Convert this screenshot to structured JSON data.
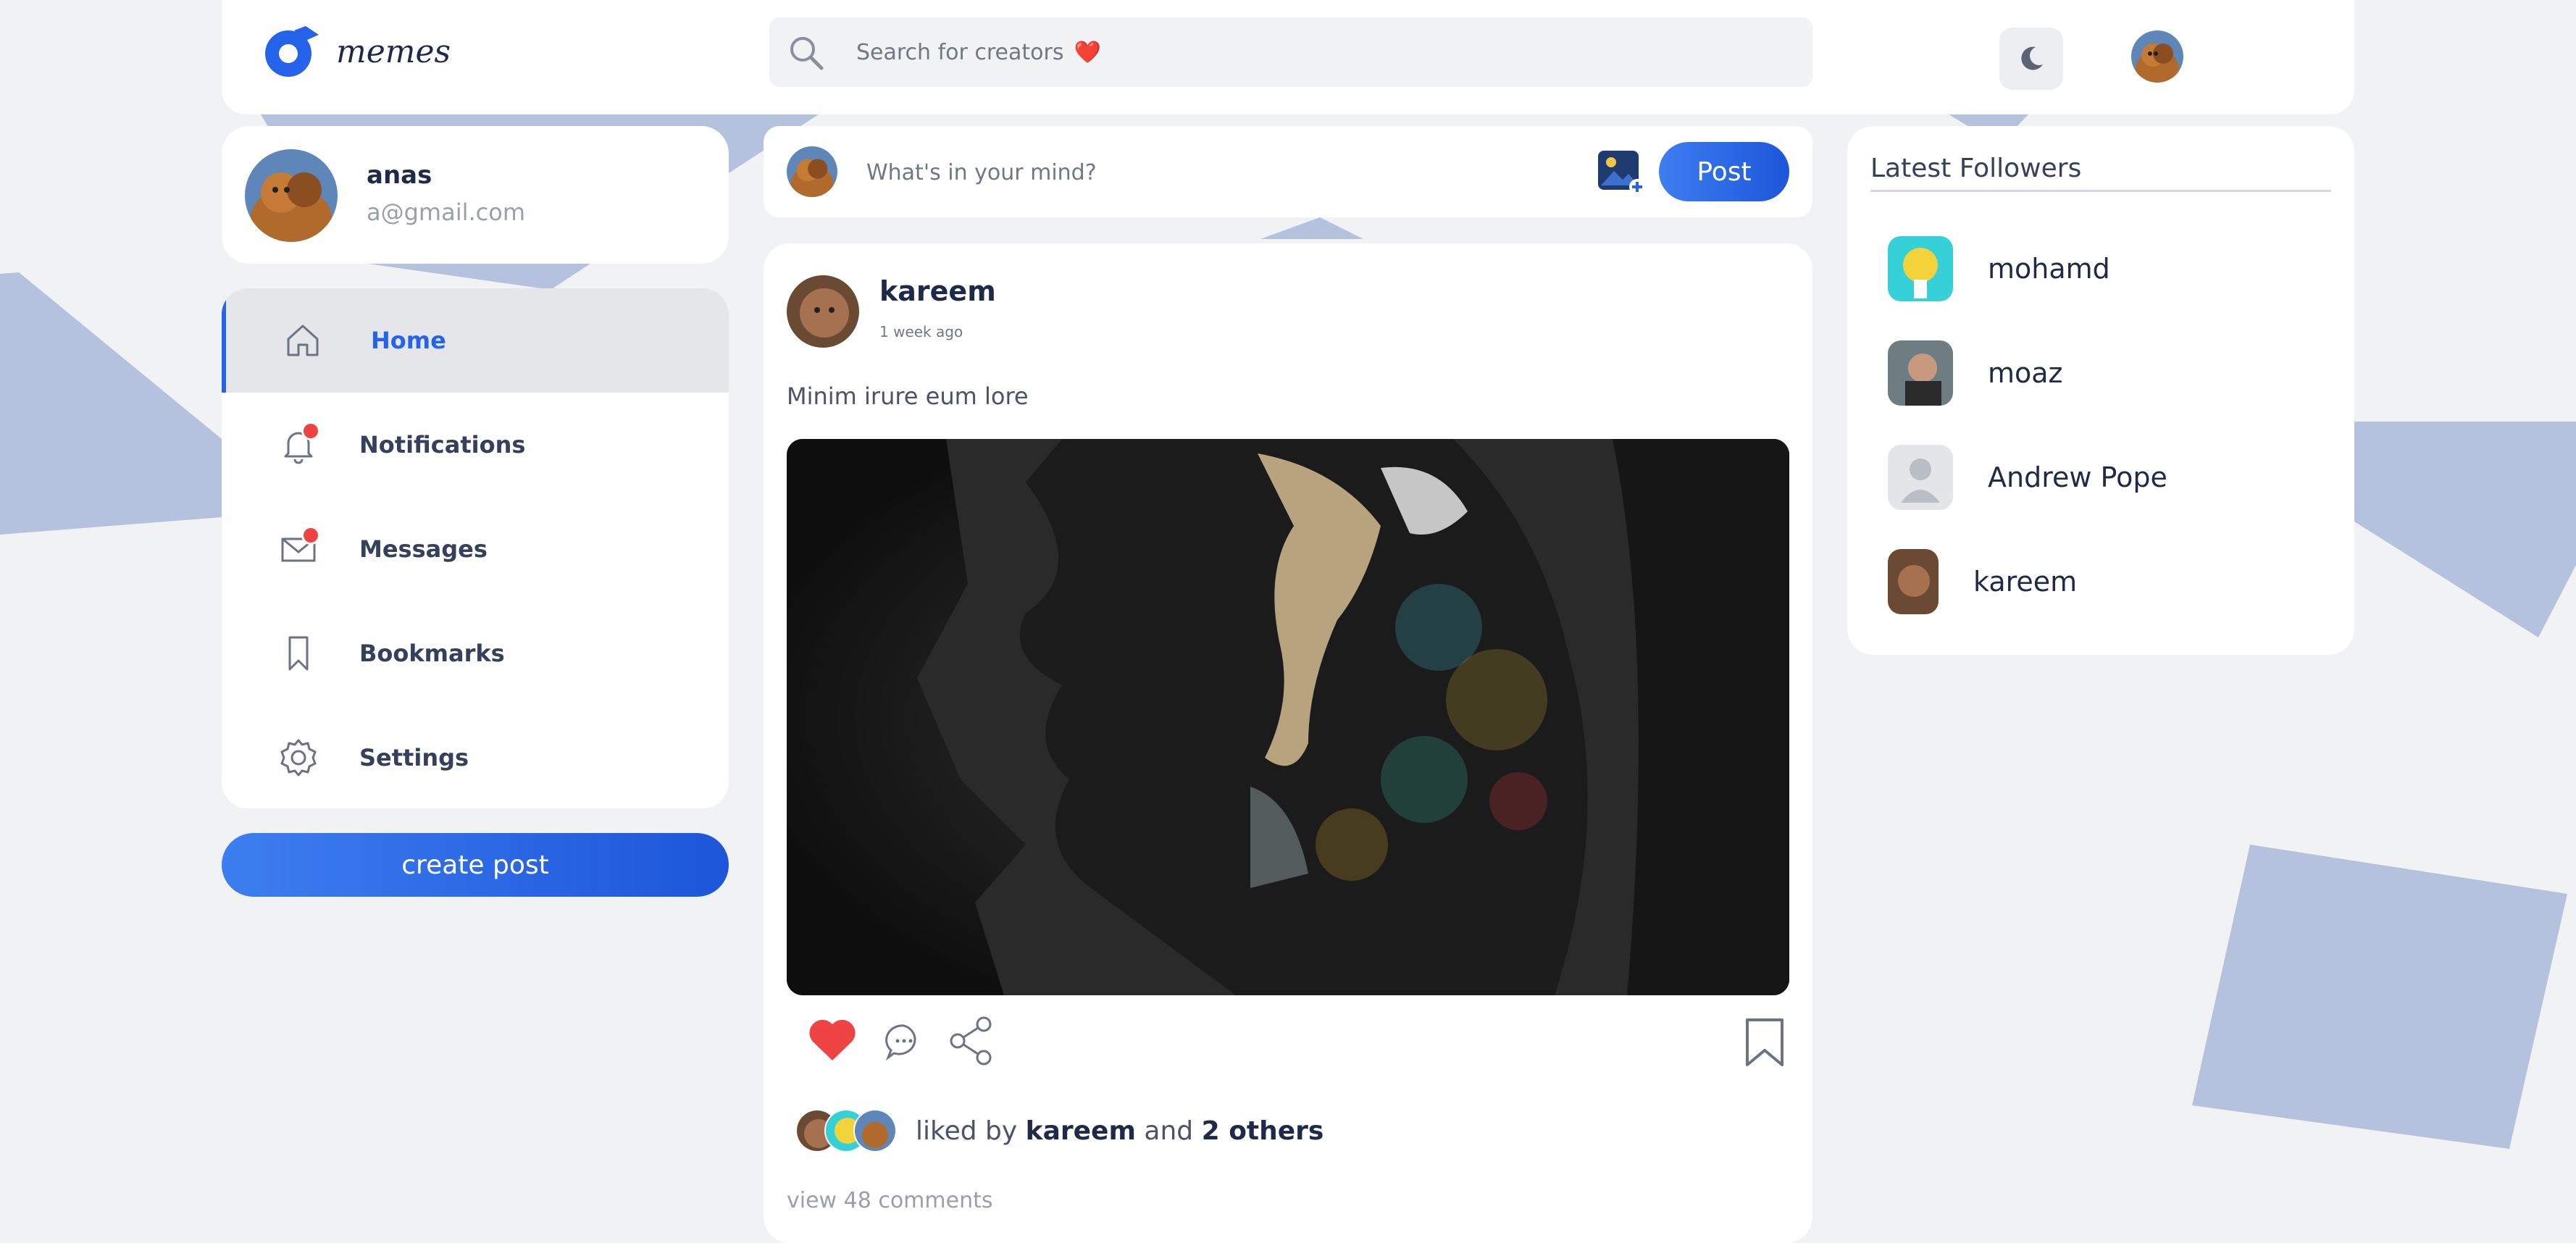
{
  "app": {
    "name": "memes",
    "accent_color": "#2563eb",
    "shape_color": "#b4c2de"
  },
  "header": {
    "search_placeholder": "Search for creators",
    "search_emoji": "❤️",
    "theme_toggle_icon": "moon-icon"
  },
  "profile": {
    "name": "anas",
    "email": "a@gmail.com"
  },
  "nav": {
    "items": [
      {
        "label": "Home",
        "icon": "home-icon",
        "active": true
      },
      {
        "label": "Notifications",
        "icon": "bell-icon",
        "badge": true
      },
      {
        "label": "Messages",
        "icon": "mail-icon",
        "badge": true
      },
      {
        "label": "Bookmarks",
        "icon": "bookmark-icon"
      },
      {
        "label": "Settings",
        "icon": "gear-icon"
      }
    ],
    "create_post_label": "create post"
  },
  "composer": {
    "placeholder": "What's in your mind?",
    "post_label": "Post"
  },
  "post": {
    "author": "kareem",
    "time": "1 week ago",
    "text": "Minim irure eum lore",
    "likes": {
      "prefix": "liked by",
      "user": "kareem",
      "conjunction": "and",
      "others": "2 others"
    },
    "comments_label": "view 48 comments",
    "liked": true
  },
  "followers": {
    "title": "Latest Followers",
    "items": [
      {
        "name": "mohamd"
      },
      {
        "name": "moaz"
      },
      {
        "name": "Andrew Pope"
      },
      {
        "name": "kareem"
      }
    ]
  }
}
